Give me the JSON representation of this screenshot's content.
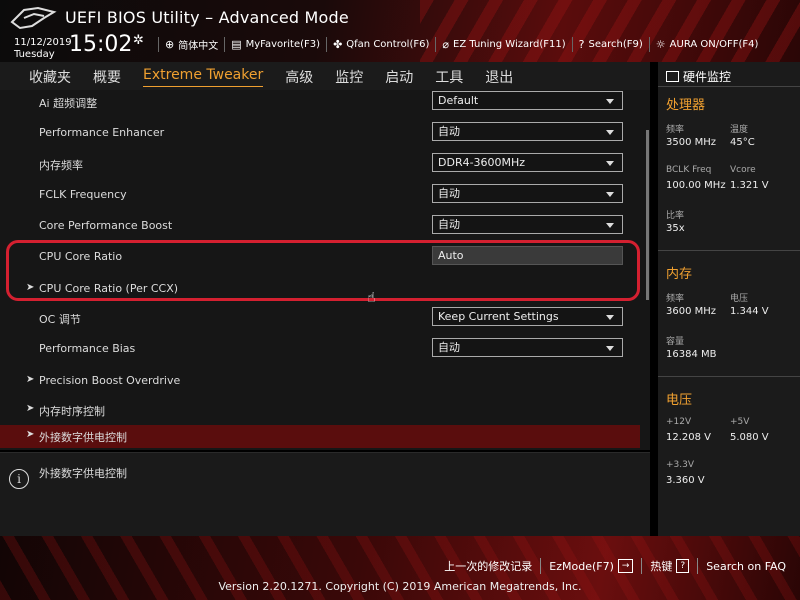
{
  "header": {
    "title": "UEFI BIOS Utility – Advanced Mode",
    "date": "11/12/2019",
    "weekday": "Tuesday",
    "time": "15:02",
    "toolbar": [
      {
        "icon": "globe-icon",
        "label": "简体中文"
      },
      {
        "icon": "favorite-icon",
        "label": "MyFavorite(F3)"
      },
      {
        "icon": "fan-icon",
        "label": "Qfan Control(F6)"
      },
      {
        "icon": "wizard-icon",
        "label": "EZ Tuning Wizard(F11)"
      },
      {
        "icon": "search-icon",
        "label": "Search(F9)"
      },
      {
        "icon": "aura-icon",
        "label": "AURA ON/OFF(F4)"
      }
    ]
  },
  "tabs": [
    "收藏夹",
    "概要",
    "Extreme Tweaker",
    "高级",
    "监控",
    "启动",
    "工具",
    "退出"
  ],
  "active_tab": "Extreme Tweaker",
  "settings": [
    {
      "label": "Ai 超频调整",
      "value": "Default",
      "type": "select"
    },
    {
      "label": "Performance Enhancer",
      "value": "自动",
      "type": "select"
    },
    {
      "label": "内存频率",
      "value": "DDR4-3600MHz",
      "type": "select"
    },
    {
      "label": "FCLK Frequency",
      "value": "自动",
      "type": "select"
    },
    {
      "label": "Core Performance Boost",
      "value": "自动",
      "type": "select"
    },
    {
      "label": "CPU Core Ratio",
      "value": "Auto",
      "type": "input"
    },
    {
      "label": "CPU Core Ratio (Per CCX)",
      "type": "submenu"
    },
    {
      "label": "OC 调节",
      "value": "Keep Current Settings",
      "type": "select"
    },
    {
      "label": "Performance Bias",
      "value": "自动",
      "type": "select"
    },
    {
      "label": "Precision Boost Overdrive",
      "type": "submenu"
    },
    {
      "label": "内存时序控制",
      "type": "submenu"
    },
    {
      "label": "外接数字供电控制",
      "type": "submenu",
      "selected": true
    }
  ],
  "help_text": "外接数字供电控制",
  "hw_monitor": {
    "title": "硬件监控",
    "cpu": {
      "title": "处理器",
      "freq_label": "频率",
      "freq": "3500 MHz",
      "temp_label": "温度",
      "temp": "45°C",
      "bclk_label": "BCLK Freq",
      "bclk": "100.00 MHz",
      "vcore_label": "Vcore",
      "vcore": "1.321 V",
      "ratio_label": "比率",
      "ratio": "35x"
    },
    "memory": {
      "title": "内存",
      "freq_label": "频率",
      "freq": "3600 MHz",
      "volt_label": "电压",
      "volt": "1.344 V",
      "cap_label": "容量",
      "cap": "16384 MB"
    },
    "voltage": {
      "title": "电压",
      "v12_label": "+12V",
      "v12": "12.208 V",
      "v5_label": "+5V",
      "v5": "5.080 V",
      "v33_label": "+3.3V",
      "v33": "3.360 V"
    }
  },
  "footer": {
    "last_modified": "上一次的修改记录",
    "ezmode": "EzMode(F7)",
    "ezmode_key": "→",
    "hotkeys": "热键",
    "hotkeys_key": "?",
    "search_faq": "Search on FAQ",
    "version": "Version 2.20.1271. Copyright (C) 2019 American Megatrends, Inc."
  }
}
